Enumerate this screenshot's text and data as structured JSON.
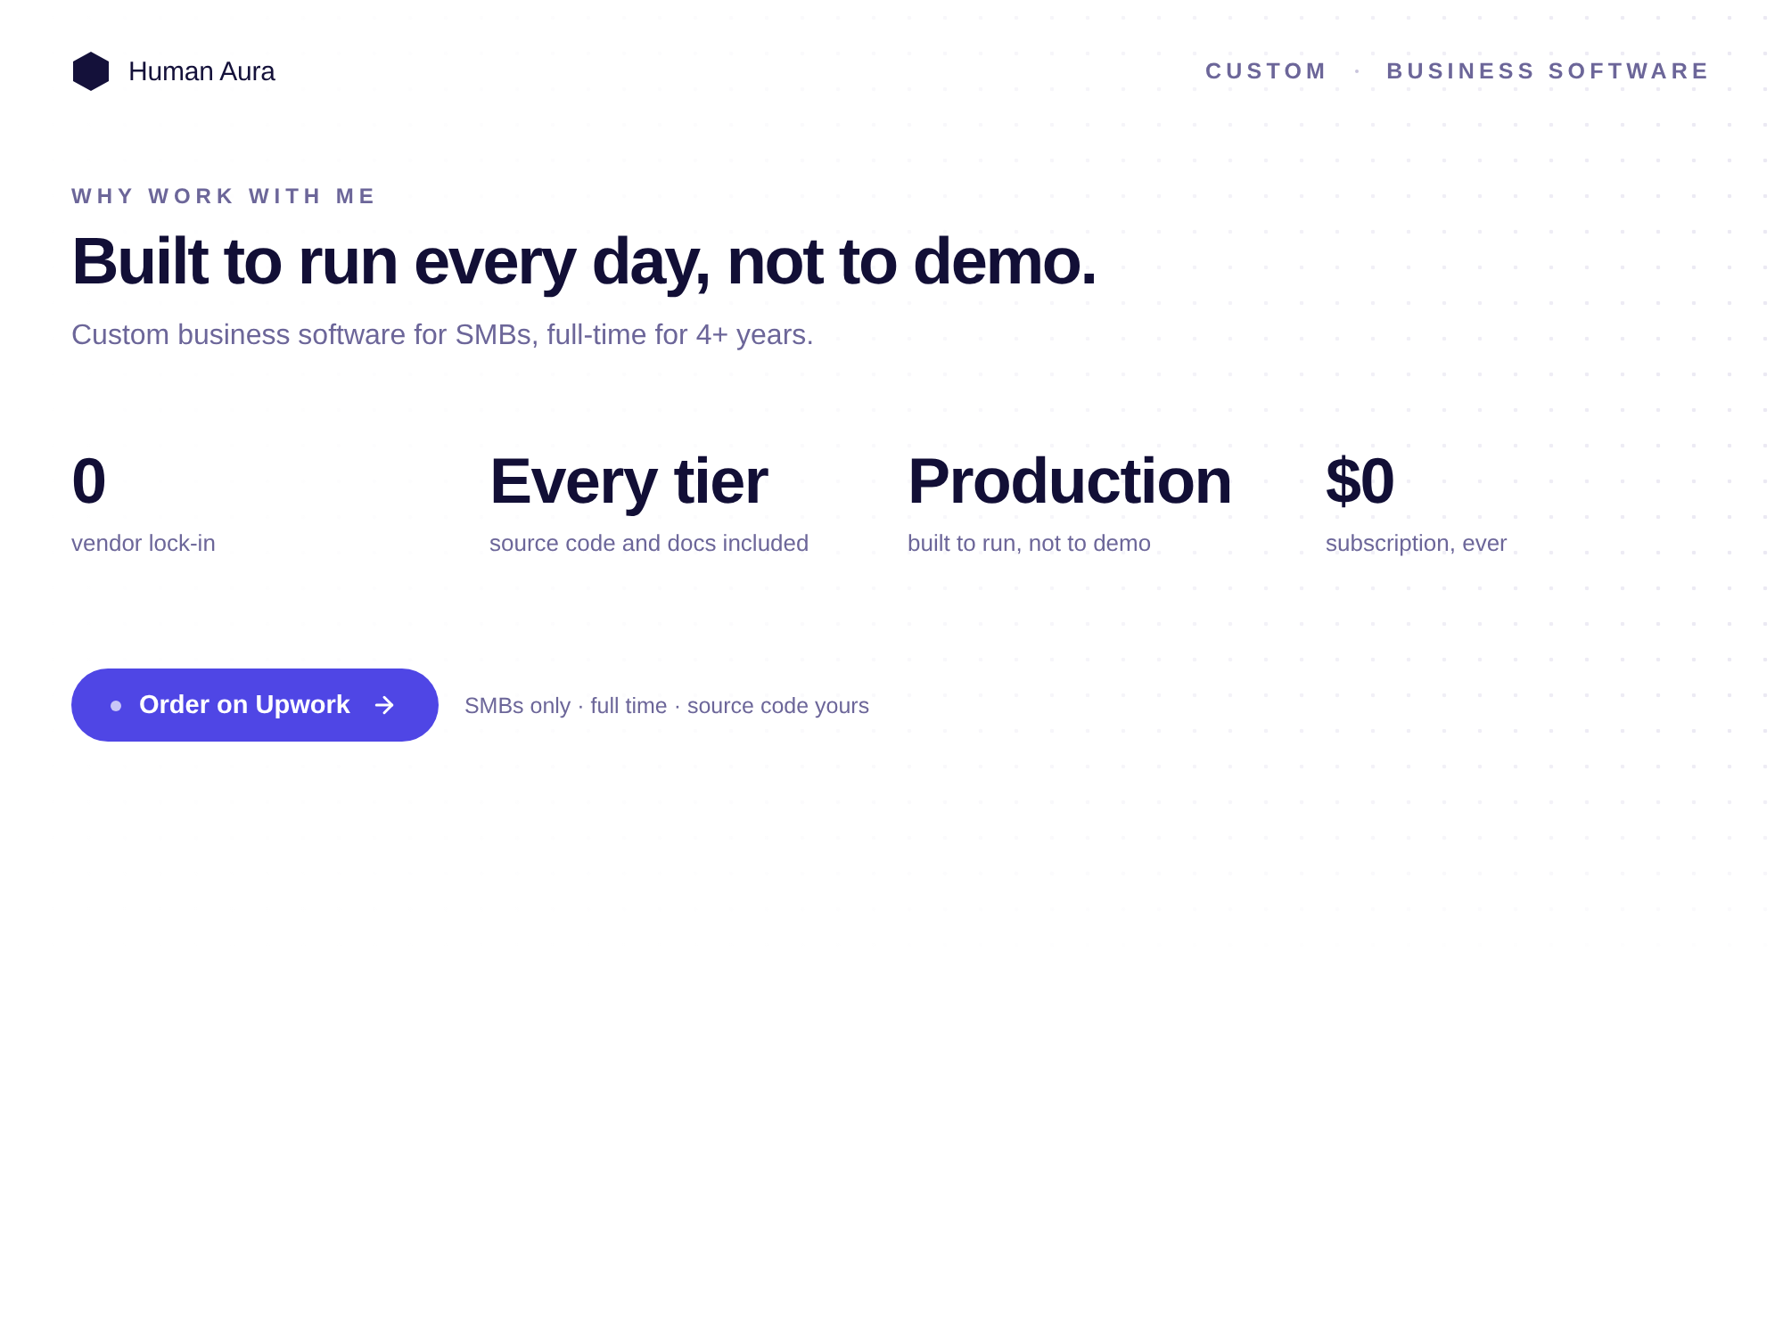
{
  "header": {
    "brand": "Human Aura",
    "tags": [
      "CUSTOM",
      "BUSINESS SOFTWARE"
    ]
  },
  "hero": {
    "eyebrow": "WHY WORK WITH ME",
    "title": "Built to run every day, not to demo.",
    "subtitle": "Custom business software for SMBs, full-time for 4+ years."
  },
  "stats": [
    {
      "value": "0",
      "label": "vendor lock-in"
    },
    {
      "value": "Every tier",
      "label": "source code and docs included"
    },
    {
      "value": "Production",
      "label": "built to run, not to demo"
    },
    {
      "value": "$0",
      "label": "subscription, ever"
    }
  ],
  "cta": {
    "button": "Order on Upwork",
    "note": "SMBs only · full time · source code yours"
  }
}
